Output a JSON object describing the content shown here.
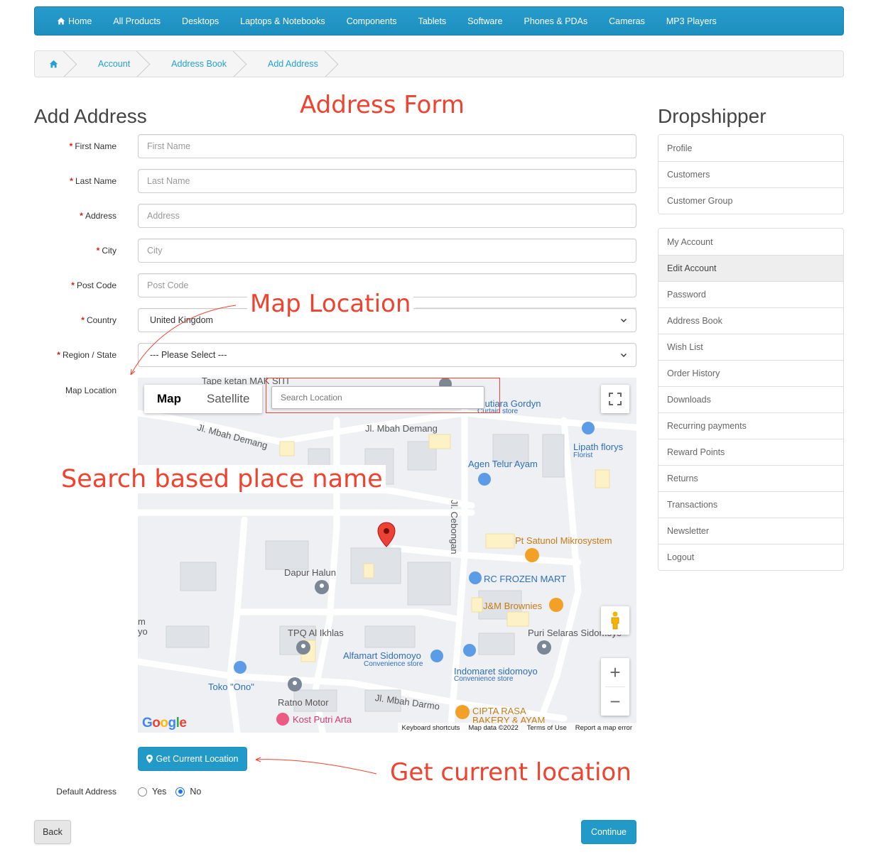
{
  "nav": {
    "items": [
      "Home",
      "All Products",
      "Desktops",
      "Laptops & Notebooks",
      "Components",
      "Tablets",
      "Software",
      "Phones & PDAs",
      "Cameras",
      "MP3 Players"
    ]
  },
  "breadcrumb": [
    "Account",
    "Address Book",
    "Add Address"
  ],
  "page_title": "Add Address",
  "annotations": {
    "address_form": "Address Form",
    "map_location": "Map Location",
    "search_place": "Search based place name",
    "get_current": "Get current location"
  },
  "form": {
    "first_name": {
      "label": "First Name",
      "placeholder": "First Name"
    },
    "last_name": {
      "label": "Last Name",
      "placeholder": "Last Name"
    },
    "address": {
      "label": "Address",
      "placeholder": "Address"
    },
    "city": {
      "label": "City",
      "placeholder": "City"
    },
    "post_code": {
      "label": "Post Code",
      "placeholder": "Post Code"
    },
    "country": {
      "label": "Country",
      "value": "United Kingdom"
    },
    "region": {
      "label": "Region / State",
      "value": "--- Please Select ---"
    },
    "map_label": "Map Location",
    "get_location_button": "Get Current Location",
    "default_address_label": "Default Address",
    "default_yes": "Yes",
    "default_no": "No",
    "default_selected": "No",
    "back_button": "Back",
    "continue_button": "Continue"
  },
  "map": {
    "type_map": "Map",
    "type_satellite": "Satellite",
    "search_placeholder": "Search Location",
    "labels": {
      "tape": "Tape ketan MAK SITI",
      "gordyn": "Putiara Gordyn",
      "curtain": "Curtain store",
      "jl_mbah_demang_1": "Jl. Mbah Demang",
      "jl_mbah_demang_2": "Jl. Mbah Demang",
      "lipath": "Lipath florys",
      "florist": "Florist",
      "agen": "Agen Telur Ayam",
      "cebongan": "Jl. Cebongan",
      "satunol": "Pt Satunol Mikrosystem",
      "dapur": "Dapur Halun",
      "frozen": "RC FROZEN MART",
      "brownies": "J&M Brownies",
      "tpq": "TPQ Al Ikhlas",
      "puri": "Puri Selaras Sidomoyo",
      "alfamart": "Alfamart Sidomoyo",
      "alfamart_sub": "Convenience store",
      "indomaret": "Indomaret sidomoyo",
      "indomaret_sub": "Convenience store",
      "toko": "Toko \"Ono\"",
      "ratno": "Ratno Motor",
      "jl_mbah_darmo": "Jl. Mbah Darmo",
      "kost": "Kost Putri Arta",
      "cipta1": "CIPTA RASA",
      "cipta2": "BAKERY & AYAM",
      "edge1": "m",
      "edge2": "yo"
    },
    "attribution": [
      "Keyboard shortcuts",
      "Map data ©2022",
      "Terms of Use",
      "Report a map error"
    ],
    "google": "Google"
  },
  "sidebar": {
    "title": "Dropshipper",
    "group1": [
      "Profile",
      "Customers",
      "Customer Group"
    ],
    "group2": [
      "My Account",
      "Edit Account",
      "Password",
      "Address Book",
      "Wish List",
      "Order History",
      "Downloads",
      "Recurring payments",
      "Reward Points",
      "Returns",
      "Transactions",
      "Newsletter",
      "Logout"
    ],
    "active": "Edit Account"
  },
  "colors": {
    "nav_bg": "#229ac8",
    "link": "#23a1d1",
    "annotation": "#f0422e",
    "required": "#d9230f"
  }
}
